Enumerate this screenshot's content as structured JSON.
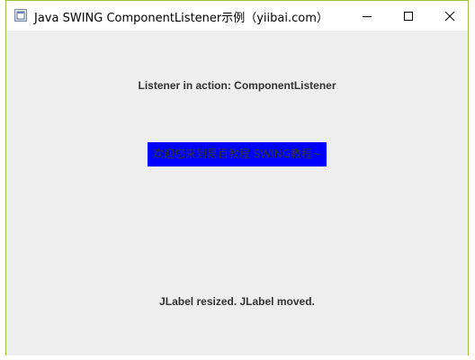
{
  "window": {
    "title": "Java SWING ComponentListener示例（yiibai.com）"
  },
  "content": {
    "heading": "Listener in action: ComponentListener",
    "blue_label": "欢迎您来到易百教程 SWING教程~",
    "status": "JLabel resized. JLabel moved."
  },
  "colors": {
    "label_background": "#0000ff",
    "window_background": "#eeeeee",
    "window_border": "#9bbf3e"
  },
  "icons": {
    "app": "java-window-icon",
    "minimize": "minimize-icon",
    "maximize": "maximize-icon",
    "close": "close-icon"
  }
}
